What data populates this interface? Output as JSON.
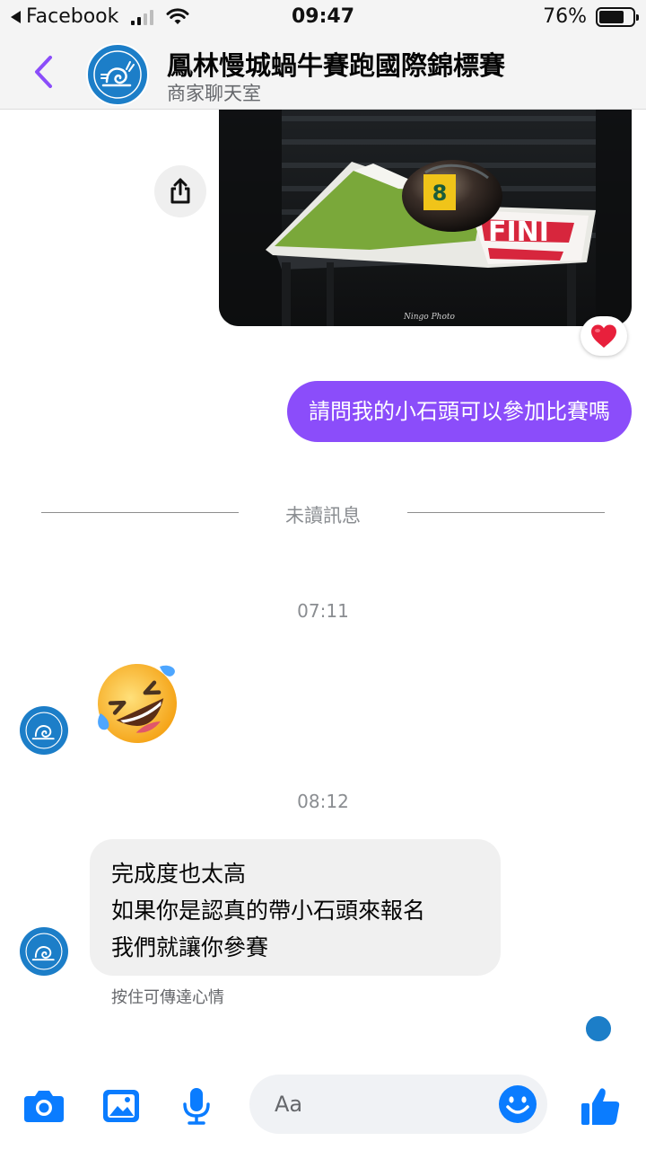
{
  "status_bar": {
    "back_app": "Facebook",
    "time": "09:47",
    "battery": "76%",
    "battery_level": 0.76,
    "signal_bars": 2
  },
  "header": {
    "title": "鳳林慢城蝸牛賽跑國際錦標賽",
    "subtitle": "商家聊天室"
  },
  "messages": {
    "outgoing_text": "請問我的小石頭可以參加比賽嗎",
    "photo_reaction": "heart",
    "unread_divider": "未讀訊息",
    "timestamp_1": "07:11",
    "emoji_reply": "rolling-on-the-floor-laughing",
    "timestamp_2": "08:12",
    "reply_lines": [
      "完成度也太高",
      "如果你是認真的帶小石頭來報名",
      "我們就讓你參賽"
    ],
    "hold_hint": "按住可傳達心情"
  },
  "photo": {
    "number_tag": "8",
    "watermark": "Ningo Photo",
    "finish_text": "FINI"
  },
  "composer": {
    "placeholder": "Aa",
    "icons": [
      "camera-icon",
      "image-icon",
      "microphone-icon",
      "emoji-icon",
      "thumbs-up-icon"
    ]
  },
  "colors": {
    "accent": "#8b4dfa",
    "messenger_blue": "#0a7cff",
    "avatar_blue": "#1c7ec8",
    "incoming_bubble": "#f0f0f0"
  }
}
